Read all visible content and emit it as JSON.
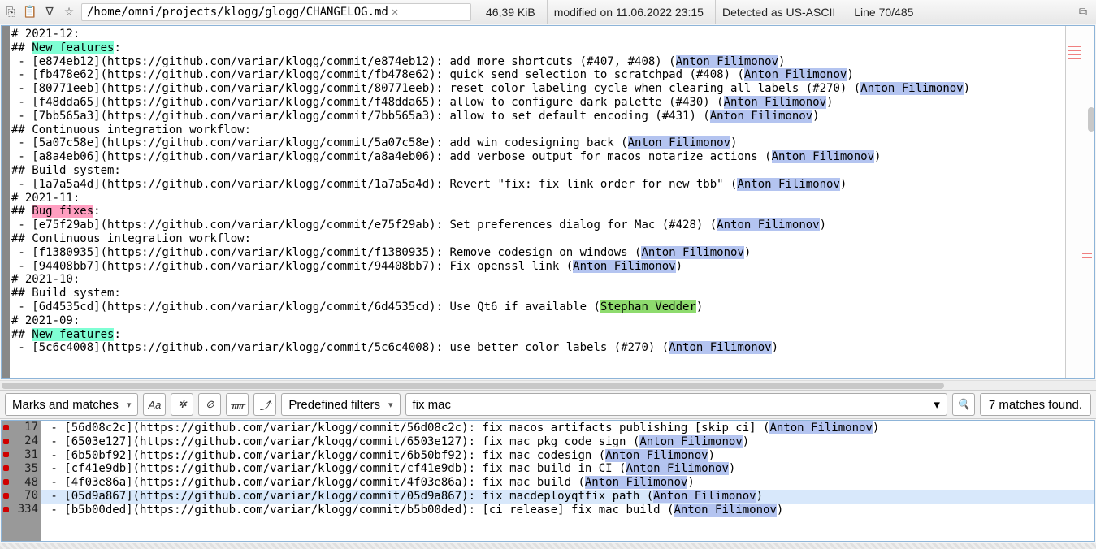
{
  "toolbar": {
    "path": "/home/omni/projects/klogg/glogg/CHANGELOG.md",
    "size": "46,39 KiB",
    "modified": "modified on 11.06.2022 23:15",
    "encoding": "Detected as US-ASCII",
    "position": "Line 70/485"
  },
  "search": {
    "mode": "Marks and matches",
    "filters": "Predefined filters",
    "query": "fix mac",
    "count": "7 matches found."
  },
  "main": {
    "lines": [
      {
        "segs": [
          {
            "t": "# 2021-12:"
          }
        ]
      },
      {
        "segs": [
          {
            "t": "## "
          },
          {
            "t": "New features",
            "cls": "hl-newfeat"
          },
          {
            "t": ":"
          }
        ]
      },
      {
        "segs": [
          {
            "t": " - [e874eb12](https://github.com/variar/klogg/commit/e874eb12): add more shortcuts (#407, #408) ("
          },
          {
            "t": "Anton Filimonov",
            "cls": "hl-author"
          },
          {
            "t": ")"
          }
        ]
      },
      {
        "segs": [
          {
            "t": " - [fb478e62](https://github.com/variar/klogg/commit/fb478e62): quick send selection to scratchpad (#408) ("
          },
          {
            "t": "Anton Filimonov",
            "cls": "hl-author"
          },
          {
            "t": ")"
          }
        ]
      },
      {
        "segs": [
          {
            "t": " - [80771eeb](https://github.com/variar/klogg/commit/80771eeb): reset color labeling cycle when clearing all labels (#270) ("
          },
          {
            "t": "Anton Filimonov",
            "cls": "hl-author"
          },
          {
            "t": ")"
          }
        ]
      },
      {
        "segs": [
          {
            "t": " - [f48dda65](https://github.com/variar/klogg/commit/f48dda65): allow to configure dark palette (#430) ("
          },
          {
            "t": "Anton Filimonov",
            "cls": "hl-author"
          },
          {
            "t": ")"
          }
        ]
      },
      {
        "segs": [
          {
            "t": " - [7bb565a3](https://github.com/variar/klogg/commit/7bb565a3): allow to set default encoding (#431) ("
          },
          {
            "t": "Anton Filimonov",
            "cls": "hl-author"
          },
          {
            "t": ")"
          }
        ]
      },
      {
        "segs": [
          {
            "t": "## Continuous integration workflow:"
          }
        ]
      },
      {
        "segs": [
          {
            "t": " - [5a07c58e](https://github.com/variar/klogg/commit/5a07c58e): add win codesigning back ("
          },
          {
            "t": "Anton Filimonov",
            "cls": "hl-author"
          },
          {
            "t": ")"
          }
        ]
      },
      {
        "segs": [
          {
            "t": " - [a8a4eb06](https://github.com/variar/klogg/commit/a8a4eb06): add verbose output for macos notarize actions ("
          },
          {
            "t": "Anton Filimonov",
            "cls": "hl-author"
          },
          {
            "t": ")"
          }
        ]
      },
      {
        "segs": [
          {
            "t": "## Build system:"
          }
        ]
      },
      {
        "segs": [
          {
            "t": " - [1a7a5a4d](https://github.com/variar/klogg/commit/1a7a5a4d): Revert \"fix: fix link order for new tbb\" ("
          },
          {
            "t": "Anton Filimonov",
            "cls": "hl-author"
          },
          {
            "t": ")"
          }
        ]
      },
      {
        "segs": [
          {
            "t": "# 2021-11:"
          }
        ]
      },
      {
        "segs": [
          {
            "t": "## "
          },
          {
            "t": "Bug fixes",
            "cls": "hl-bugfix"
          },
          {
            "t": ":"
          }
        ]
      },
      {
        "segs": [
          {
            "t": " - [e75f29ab](https://github.com/variar/klogg/commit/e75f29ab): Set preferences dialog for Mac (#428) ("
          },
          {
            "t": "Anton Filimonov",
            "cls": "hl-author"
          },
          {
            "t": ")"
          }
        ]
      },
      {
        "segs": [
          {
            "t": "## Continuous integration workflow:"
          }
        ]
      },
      {
        "segs": [
          {
            "t": " - [f1380935](https://github.com/variar/klogg/commit/f1380935): Remove codesign on windows ("
          },
          {
            "t": "Anton Filimonov",
            "cls": "hl-author"
          },
          {
            "t": ")"
          }
        ]
      },
      {
        "segs": [
          {
            "t": " - [94408bb7](https://github.com/variar/klogg/commit/94408bb7): Fix openssl link ("
          },
          {
            "t": "Anton Filimonov",
            "cls": "hl-author"
          },
          {
            "t": ")"
          }
        ]
      },
      {
        "segs": [
          {
            "t": "# 2021-10:"
          }
        ]
      },
      {
        "segs": [
          {
            "t": "## Build system:"
          }
        ]
      },
      {
        "segs": [
          {
            "t": " - [6d4535cd](https://github.com/variar/klogg/commit/6d4535cd): Use Qt6 if available ("
          },
          {
            "t": "Stephan Vedder",
            "cls": "hl-author2"
          },
          {
            "t": ")"
          }
        ]
      },
      {
        "segs": [
          {
            "t": "# 2021-09:"
          }
        ]
      },
      {
        "segs": [
          {
            "t": "## "
          },
          {
            "t": "New features",
            "cls": "hl-newfeat"
          },
          {
            "t": ":"
          }
        ]
      },
      {
        "segs": [
          {
            "t": " - [5c6c4008](https://github.com/variar/klogg/commit/5c6c4008): use better color labels (#270) ("
          },
          {
            "t": "Anton Filimonov",
            "cls": "hl-author"
          },
          {
            "t": ")"
          }
        ]
      }
    ]
  },
  "results": {
    "rows": [
      {
        "num": "17",
        "sel": false,
        "segs": [
          {
            "t": " - [56d08c2c](https://github.com/variar/klogg/commit/56d08c2c): fix macos artifacts publishing [skip ci] ("
          },
          {
            "t": "Anton Filimonov",
            "cls": "hl-author"
          },
          {
            "t": ")"
          }
        ]
      },
      {
        "num": "24",
        "sel": false,
        "segs": [
          {
            "t": " - [6503e127](https://github.com/variar/klogg/commit/6503e127): fix mac pkg code sign ("
          },
          {
            "t": "Anton Filimonov",
            "cls": "hl-author"
          },
          {
            "t": ")"
          }
        ]
      },
      {
        "num": "31",
        "sel": false,
        "segs": [
          {
            "t": " - [6b50bf92](https://github.com/variar/klogg/commit/6b50bf92): fix mac codesign ("
          },
          {
            "t": "Anton Filimonov",
            "cls": "hl-author"
          },
          {
            "t": ")"
          }
        ]
      },
      {
        "num": "35",
        "sel": false,
        "segs": [
          {
            "t": " - [cf41e9db](https://github.com/variar/klogg/commit/cf41e9db): fix mac build in CI ("
          },
          {
            "t": "Anton Filimonov",
            "cls": "hl-author"
          },
          {
            "t": ")"
          }
        ]
      },
      {
        "num": "48",
        "sel": false,
        "segs": [
          {
            "t": " - [4f03e86a](https://github.com/variar/klogg/commit/4f03e86a): fix mac build ("
          },
          {
            "t": "Anton Filimonov",
            "cls": "hl-author"
          },
          {
            "t": ")"
          }
        ]
      },
      {
        "num": "70",
        "sel": true,
        "segs": [
          {
            "t": " - [05d9a867](https://github.com/variar/klogg/commit/05d9a867): fix macdeployqtfix path ("
          },
          {
            "t": "Anton Filimonov",
            "cls": "hl-author"
          },
          {
            "t": ")"
          }
        ]
      },
      {
        "num": "334",
        "sel": false,
        "segs": [
          {
            "t": " - [b5b00ded](https://github.com/variar/klogg/commit/b5b00ded): [ci release] fix mac build ("
          },
          {
            "t": "Anton Filimonov",
            "cls": "hl-author"
          },
          {
            "t": ")"
          }
        ]
      }
    ]
  }
}
